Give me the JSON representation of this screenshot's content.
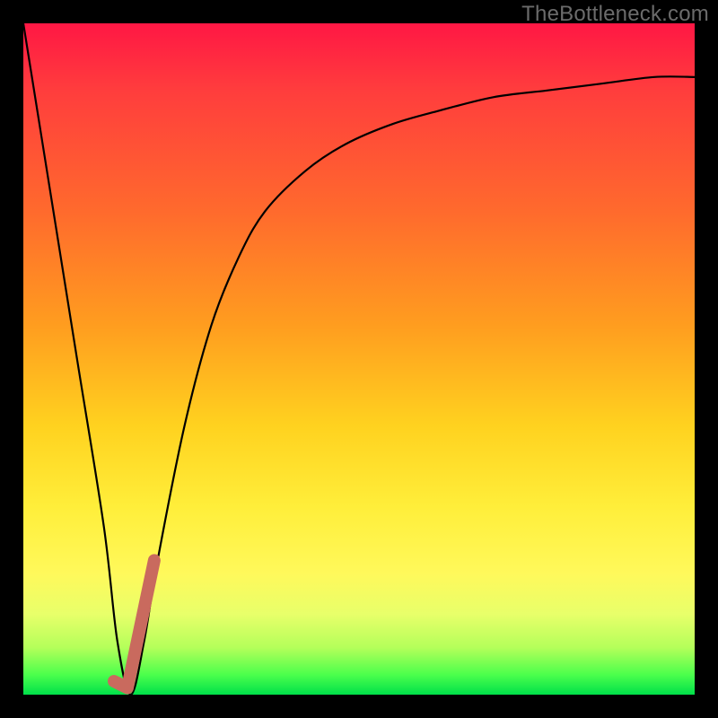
{
  "watermark": "TheBottleneck.com",
  "chart_data": {
    "type": "line",
    "title": "",
    "xlabel": "",
    "ylabel": "",
    "xlim": [
      0,
      100
    ],
    "ylim": [
      0,
      100
    ],
    "grid": false,
    "legend": false,
    "series": [
      {
        "name": "bottleneck-curve",
        "x": [
          0,
          4,
          8,
          12,
          14,
          16,
          18,
          20,
          24,
          28,
          32,
          36,
          42,
          48,
          55,
          62,
          70,
          78,
          86,
          94,
          100
        ],
        "values": [
          100,
          75,
          50,
          25,
          8,
          0,
          8,
          20,
          40,
          55,
          65,
          72,
          78,
          82,
          85,
          87,
          89,
          90,
          91,
          92,
          92
        ]
      }
    ],
    "marker": {
      "name": "highlight-J",
      "points_x": [
        13.5,
        15.5,
        19.5
      ],
      "points_y": [
        2,
        1,
        20
      ]
    },
    "background_gradient": {
      "top": "#ff1744",
      "mid": "#ffd21f",
      "bottom": "#00e04a"
    }
  }
}
